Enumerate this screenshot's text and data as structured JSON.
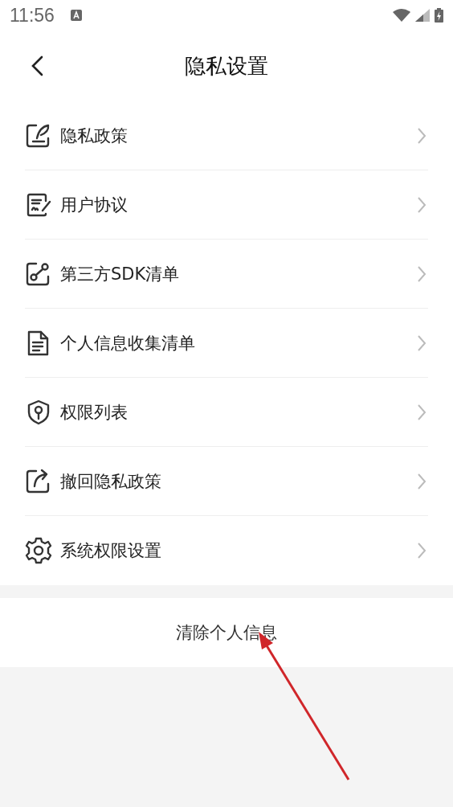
{
  "status_bar": {
    "time": "11:56"
  },
  "header": {
    "title": "隐私设置"
  },
  "items": [
    {
      "label": "隐私政策",
      "kind": "quill"
    },
    {
      "label": "用户协议",
      "kind": "signed-doc"
    },
    {
      "label": "第三方SDK清单",
      "kind": "share-node"
    },
    {
      "label": "个人信息收集清单",
      "kind": "document"
    },
    {
      "label": "权限列表",
      "kind": "shield-key"
    },
    {
      "label": "撤回隐私政策",
      "kind": "share-out"
    },
    {
      "label": "系统权限设置",
      "kind": "gear"
    }
  ],
  "clear_button": {
    "label": "清除个人信息"
  },
  "annotation": {
    "kind": "arrow"
  }
}
